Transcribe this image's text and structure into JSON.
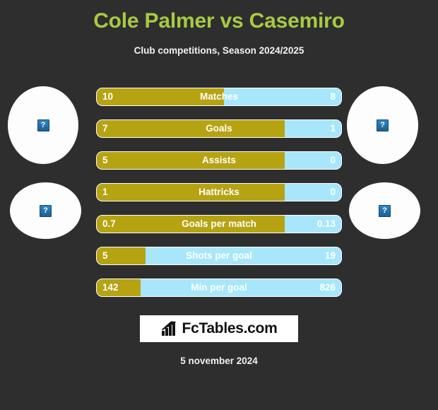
{
  "header": {
    "title": "Cole Palmer vs Casemiro",
    "subtitle": "Club competitions, Season 2024/2025",
    "title_color": "#a9ca42"
  },
  "avatars": {
    "placeholder_glyph": "?",
    "items": [
      {
        "name": "player-left-primary-photo"
      },
      {
        "name": "player-left-secondary-photo"
      },
      {
        "name": "player-right-primary-photo"
      },
      {
        "name": "player-right-secondary-photo"
      }
    ]
  },
  "colors": {
    "background": "#2e2e2e",
    "left_player": "#b6a312",
    "right_player": "#a8e7fb",
    "text": "#ffffff"
  },
  "chart_data": {
    "type": "bar",
    "title": "Cole Palmer vs Casemiro",
    "subtitle": "Club competitions, Season 2024/2025",
    "xlabel": "",
    "ylabel": "",
    "legend": [
      "Cole Palmer",
      "Casemiro"
    ],
    "legend_position": "none",
    "grid": false,
    "orientation": "horizontal-diverging",
    "categories": [
      "Matches",
      "Goals",
      "Assists",
      "Hattricks",
      "Goals per match",
      "Shots per goal",
      "Min per goal"
    ],
    "series": [
      {
        "name": "Cole Palmer",
        "color": "#b6a312",
        "values": [
          10,
          7,
          5,
          1,
          0.7,
          5,
          142
        ]
      },
      {
        "name": "Casemiro",
        "color": "#a8e7fb",
        "values": [
          8,
          1,
          0,
          0,
          0.13,
          19,
          826
        ]
      }
    ],
    "rows": [
      {
        "label": "Matches",
        "left": "10",
        "right": "8",
        "left_pct": 52
      },
      {
        "label": "Goals",
        "left": "7",
        "right": "1",
        "left_pct": 77
      },
      {
        "label": "Assists",
        "left": "5",
        "right": "0",
        "left_pct": 77
      },
      {
        "label": "Hattricks",
        "left": "1",
        "right": "0",
        "left_pct": 77
      },
      {
        "label": "Goals per match",
        "left": "0.7",
        "right": "0.13",
        "left_pct": 77
      },
      {
        "label": "Shots per goal",
        "left": "5",
        "right": "19",
        "left_pct": 20
      },
      {
        "label": "Min per goal",
        "left": "142",
        "right": "826",
        "left_pct": 18
      }
    ]
  },
  "footer": {
    "brand": "FcTables.com",
    "date": "5 november 2024"
  }
}
